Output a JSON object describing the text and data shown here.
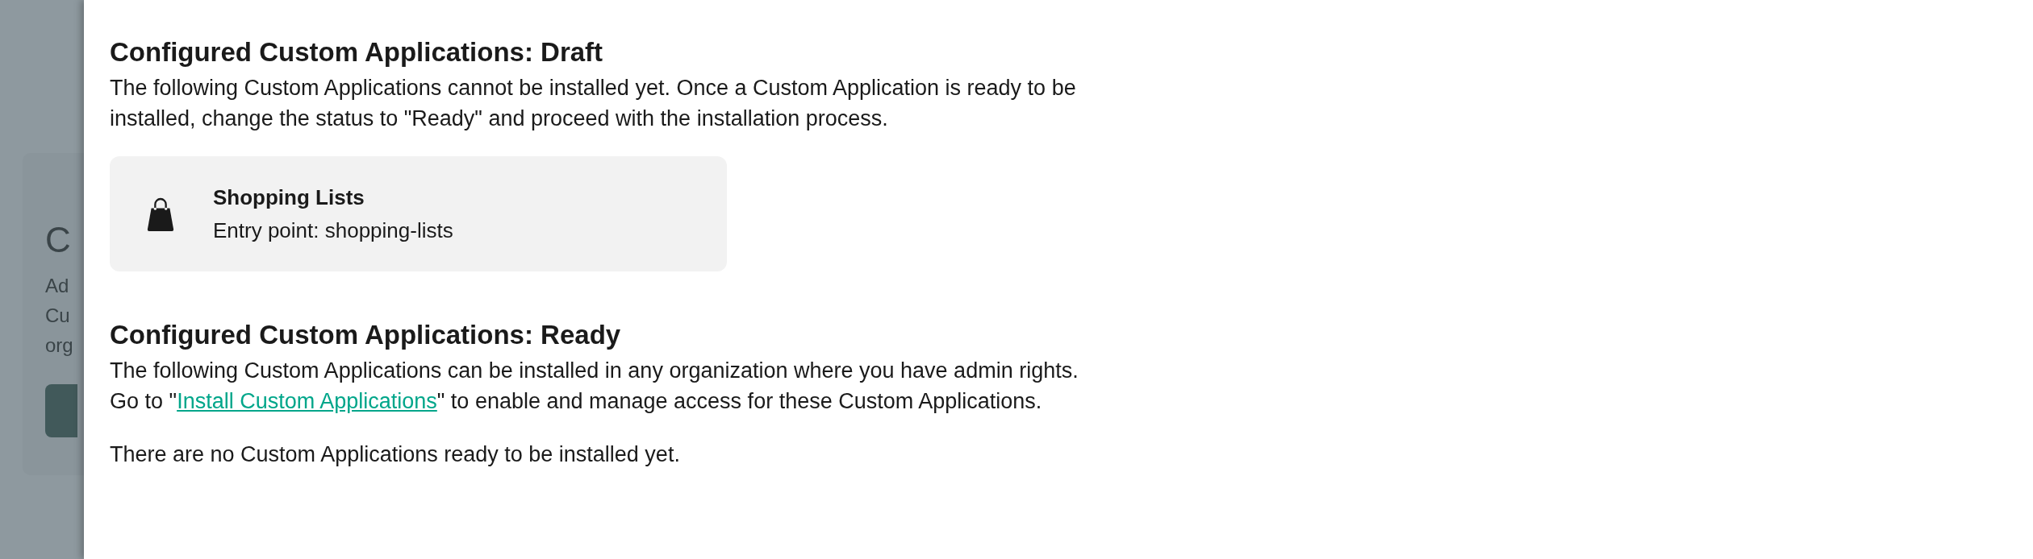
{
  "background_page": {
    "heading_fragment": "C",
    "description_fragments": [
      "Ad",
      "Cu",
      "org"
    ]
  },
  "draft_section": {
    "title": "Configured Custom Applications: Draft",
    "description": "The following Custom Applications cannot be installed yet. Once a Custom Application is ready to be installed, change the status to \"Ready\" and proceed with the installation process.",
    "applications": [
      {
        "name": "Shopping Lists",
        "entry_point": "Entry point: shopping-lists"
      }
    ]
  },
  "ready_section": {
    "title": "Configured Custom Applications: Ready",
    "description_line_1": "The following Custom Applications can be installed in any organization where you have admin rights.",
    "description_before_link": "Go to \"",
    "link": "Install Custom Applications",
    "description_after_link": "\" to enable and manage access for these Custom Applications.",
    "empty_message": "There are no Custom Applications ready to be installed yet."
  }
}
